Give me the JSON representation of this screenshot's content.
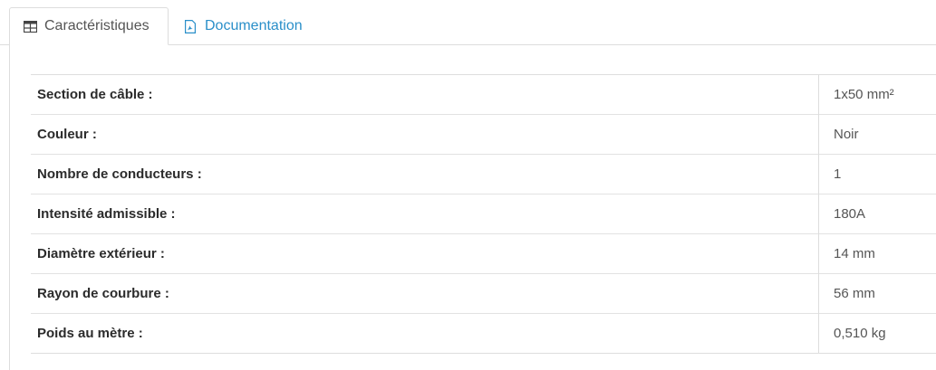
{
  "tabs": [
    {
      "label": "Caractéristiques",
      "icon": "table-icon",
      "active": true
    },
    {
      "label": "Documentation",
      "icon": "pdf-file-icon",
      "active": false
    }
  ],
  "colors": {
    "link": "#2a8fc9",
    "border": "#dddddd",
    "text": "#333333"
  },
  "specs": {
    "rows": [
      {
        "key": "Section de câble :",
        "value": "1x50 mm²"
      },
      {
        "key": "Couleur :",
        "value": "Noir"
      },
      {
        "key": "Nombre de conducteurs :",
        "value": "1"
      },
      {
        "key": "Intensité admissible :",
        "value": "180A"
      },
      {
        "key": "Diamètre extérieur :",
        "value": "14 mm"
      },
      {
        "key": "Rayon de courbure :",
        "value": "56 mm"
      },
      {
        "key": "Poids au mètre :",
        "value": "0,510 kg"
      }
    ]
  }
}
